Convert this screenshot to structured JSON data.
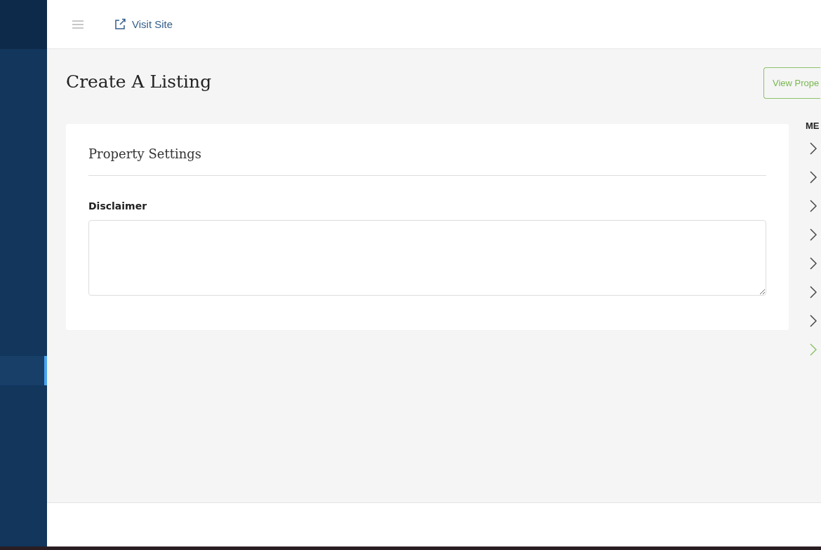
{
  "topbar": {
    "link": "Visit Site"
  },
  "page": {
    "title": "Create A Listing",
    "button": "View Prope"
  },
  "card": {
    "title": "Property Settings",
    "field_label": "Disclaimer"
  },
  "menu": {
    "heading": "ME",
    "items": [
      {
        "selected": false
      },
      {
        "selected": false
      },
      {
        "selected": false
      },
      {
        "selected": false
      },
      {
        "selected": false
      },
      {
        "selected": false
      },
      {
        "selected": false
      },
      {
        "selected": true
      }
    ]
  },
  "sidebar": {
    "items": [
      {
        "selected": true
      }
    ]
  }
}
